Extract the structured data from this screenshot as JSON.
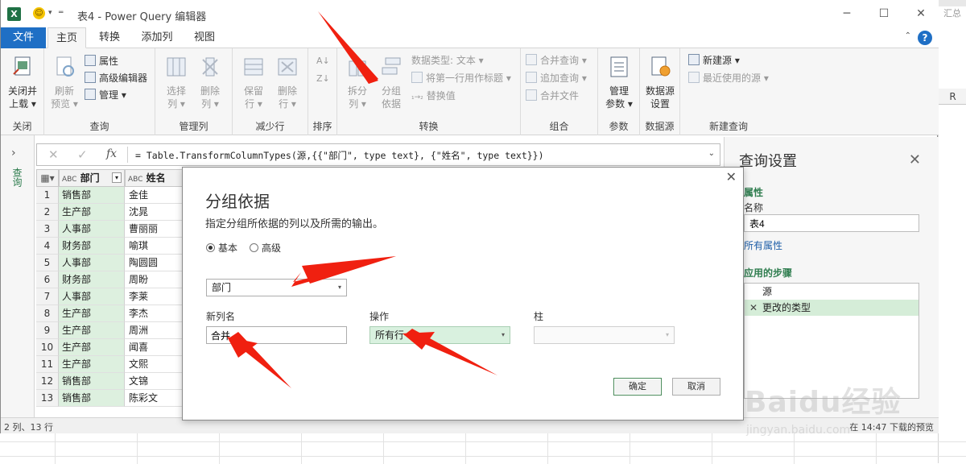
{
  "window": {
    "title": "表4 - Power Query 编辑器",
    "app_icon": "X"
  },
  "tabs": [
    "文件",
    "主页",
    "转换",
    "添加列",
    "视图"
  ],
  "ribbon": {
    "close": {
      "label1": "关闭并",
      "label2": "上载",
      "group": "关闭"
    },
    "query": {
      "refresh1": "刷新",
      "refresh2": "预览",
      "properties": "属性",
      "advanced_editor": "高级编辑器",
      "manage": "管理",
      "group": "查询"
    },
    "manage_cols": {
      "choose1": "选择",
      "choose2": "列",
      "remove1": "删除",
      "remove2": "列",
      "group": "管理列"
    },
    "reduce_rows": {
      "keep1": "保留",
      "keep2": "行",
      "remove1": "删除",
      "remove2": "行",
      "group": "减少行"
    },
    "sort": {
      "group": "排序"
    },
    "transform": {
      "split1": "拆分",
      "split2": "列",
      "groupby1": "分组",
      "groupby2": "依据",
      "datatype": "数据类型: 文本",
      "first_row_header": "将第一行用作标题",
      "replace": "替换值",
      "group": "转换"
    },
    "combine": {
      "merge": "合并查询",
      "append": "追加查询",
      "merge_files": "合并文件",
      "group": "组合"
    },
    "params": {
      "manage1": "管理",
      "manage2": "参数",
      "group": "参数"
    },
    "datasource": {
      "settings1": "数据源",
      "settings2": "设置",
      "group": "数据源"
    },
    "newquery": {
      "new_source": "新建源",
      "recent": "最近使用的源",
      "group": "新建查询"
    }
  },
  "formula": "= Table.TransformColumnTypes(源,{{\"部门\", type text}, {\"姓名\", type text}})",
  "grid": {
    "col1": "部门",
    "col2": "姓名",
    "type_prefix": "ABC",
    "rows": [
      {
        "i": "1",
        "dept": "销售部",
        "name": "金佳"
      },
      {
        "i": "2",
        "dept": "生产部",
        "name": "沈晁"
      },
      {
        "i": "3",
        "dept": "人事部",
        "name": "曹丽丽"
      },
      {
        "i": "4",
        "dept": "财务部",
        "name": "喻琪"
      },
      {
        "i": "5",
        "dept": "人事部",
        "name": "陶圆圆"
      },
      {
        "i": "6",
        "dept": "财务部",
        "name": "周盼"
      },
      {
        "i": "7",
        "dept": "人事部",
        "name": "李莱"
      },
      {
        "i": "8",
        "dept": "生产部",
        "name": "李杰"
      },
      {
        "i": "9",
        "dept": "生产部",
        "name": "周洲"
      },
      {
        "i": "10",
        "dept": "生产部",
        "name": "闻喜"
      },
      {
        "i": "11",
        "dept": "生产部",
        "name": "文熙"
      },
      {
        "i": "12",
        "dept": "销售部",
        "name": "文锦"
      },
      {
        "i": "13",
        "dept": "销售部",
        "name": "陈彩文"
      }
    ]
  },
  "left_panel_label": "查询",
  "status": {
    "left": "2 列、13 行",
    "right": "在 14:47 下载的预览"
  },
  "settings": {
    "title": "查询设置",
    "properties": "属性",
    "name_label": "名称",
    "name_value": "表4",
    "all_properties": "所有属性",
    "applied_steps": "应用的步骤",
    "steps": [
      "源",
      "更改的类型"
    ]
  },
  "dialog": {
    "title": "分组依据",
    "description": "指定分组所依据的列以及所需的输出。",
    "radio_basic": "基本",
    "radio_advanced": "高级",
    "group_column": "部门",
    "new_col_label": "新列名",
    "new_col_value": "合并",
    "op_label": "操作",
    "op_value": "所有行",
    "col_label": "柱",
    "col_value": "",
    "ok": "确定",
    "cancel": "取消"
  },
  "excel_behind": {
    "col_letter": "R",
    "sum_text": "汇总"
  },
  "watermark": {
    "brand": "Baidu经验",
    "url": "jingyan.baidu.com"
  }
}
